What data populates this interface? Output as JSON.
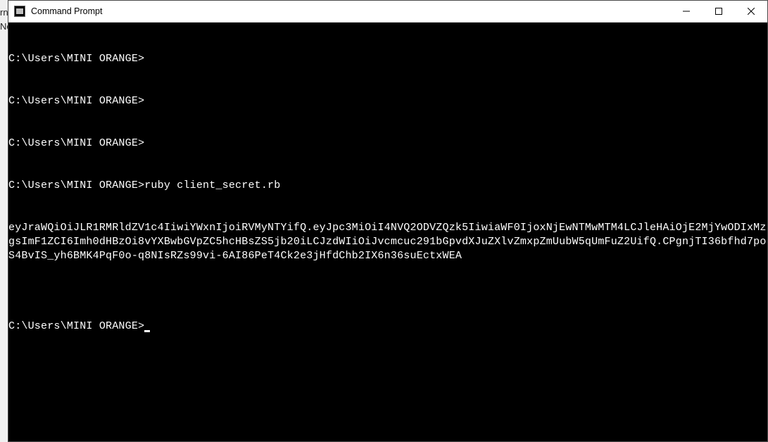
{
  "bg": {
    "line1": "rn",
    "line2": "Nc"
  },
  "window": {
    "title": "Command Prompt"
  },
  "terminal": {
    "prompt": "C:\\Users\\MINI ORANGE>",
    "lines": [
      "C:\\Users\\MINI ORANGE>",
      "C:\\Users\\MINI ORANGE>",
      "C:\\Users\\MINI ORANGE>",
      "C:\\Users\\MINI ORANGE>ruby client_secret.rb"
    ],
    "output": "eyJraWQiOiJLR1RMRldZV1c4IiwiYWxnIjoiRVMyNTYifQ.eyJpc3MiOiI4NVQ2ODVZQzk5IiwiaWF0IjoxNjEwNTMwMTM4LCJleHAiOjE2MjYwODIxMzgsImF1ZCI6Imh0dHBzOi8vYXBwbGVpZC5hcHBsZS5jb20iLCJzdWIiOiJvcmcuc291bGpvdXJuZXlvZmxpZmUubW5qUmFuZ2UifQ.CPgnjTI36bfhd7poS4BvIS_yh6BMK4PqF0o-q8NIsRZs99vi-6AI86PeT4Ck2e3jHfdChb2IX6n36suEctxWEA",
    "blank": ""
  }
}
